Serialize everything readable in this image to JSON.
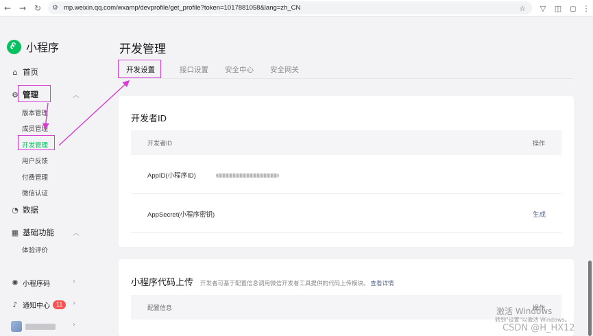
{
  "browser": {
    "url": "mp.weixin.qq.com/wxamp/devprofile/get_profile?token=1017881058&lang=zh_CN",
    "icons": [
      "back-arrow-icon",
      "forward-arrow-icon",
      "reload-icon",
      "site-info-icon",
      "bookmark-star-icon",
      "extension-shield-icon",
      "extensions-puzzle-icon",
      "profile-icon",
      "menu-icon"
    ]
  },
  "sidebar": {
    "brand": "小程序",
    "home": "首页",
    "manage": "管理",
    "manage_items": [
      "版本管理",
      "成员管理",
      "开发管理",
      "用户反馈",
      "付费管理",
      "微信认证"
    ],
    "data": "数据",
    "basic": "基础功能",
    "basic_items": [
      "体验评价"
    ],
    "qrcode": "小程序码",
    "notice": "通知中心",
    "notice_count": "11"
  },
  "main": {
    "title": "开发管理",
    "tabs": [
      "开发设置",
      "接口设置",
      "安全中心",
      "安全网关"
    ],
    "dev_card": {
      "title": "开发者ID",
      "col_id": "开发者ID",
      "col_action": "操作",
      "rows": [
        {
          "label": "AppID(小程序ID)",
          "action": ""
        },
        {
          "label": "AppSecret(小程序密钥)",
          "action": "生成"
        }
      ]
    },
    "upload_card": {
      "title": "小程序代码上传",
      "desc": "开发者可基于配置信息调用微信开发者工具提供的代码上传模块。",
      "link": "查看详情",
      "col_config": "配置信息",
      "col_action": "操作"
    }
  },
  "watermark": {
    "win1": "激活 Windows",
    "win2": "转到\"设置\"以激活 Windows。",
    "csdn": "CSDN @H_HX12"
  },
  "colors": {
    "accent": "#07c160",
    "annotation": "#d63cd4",
    "link": "#576b95",
    "badge": "#fa5151"
  }
}
